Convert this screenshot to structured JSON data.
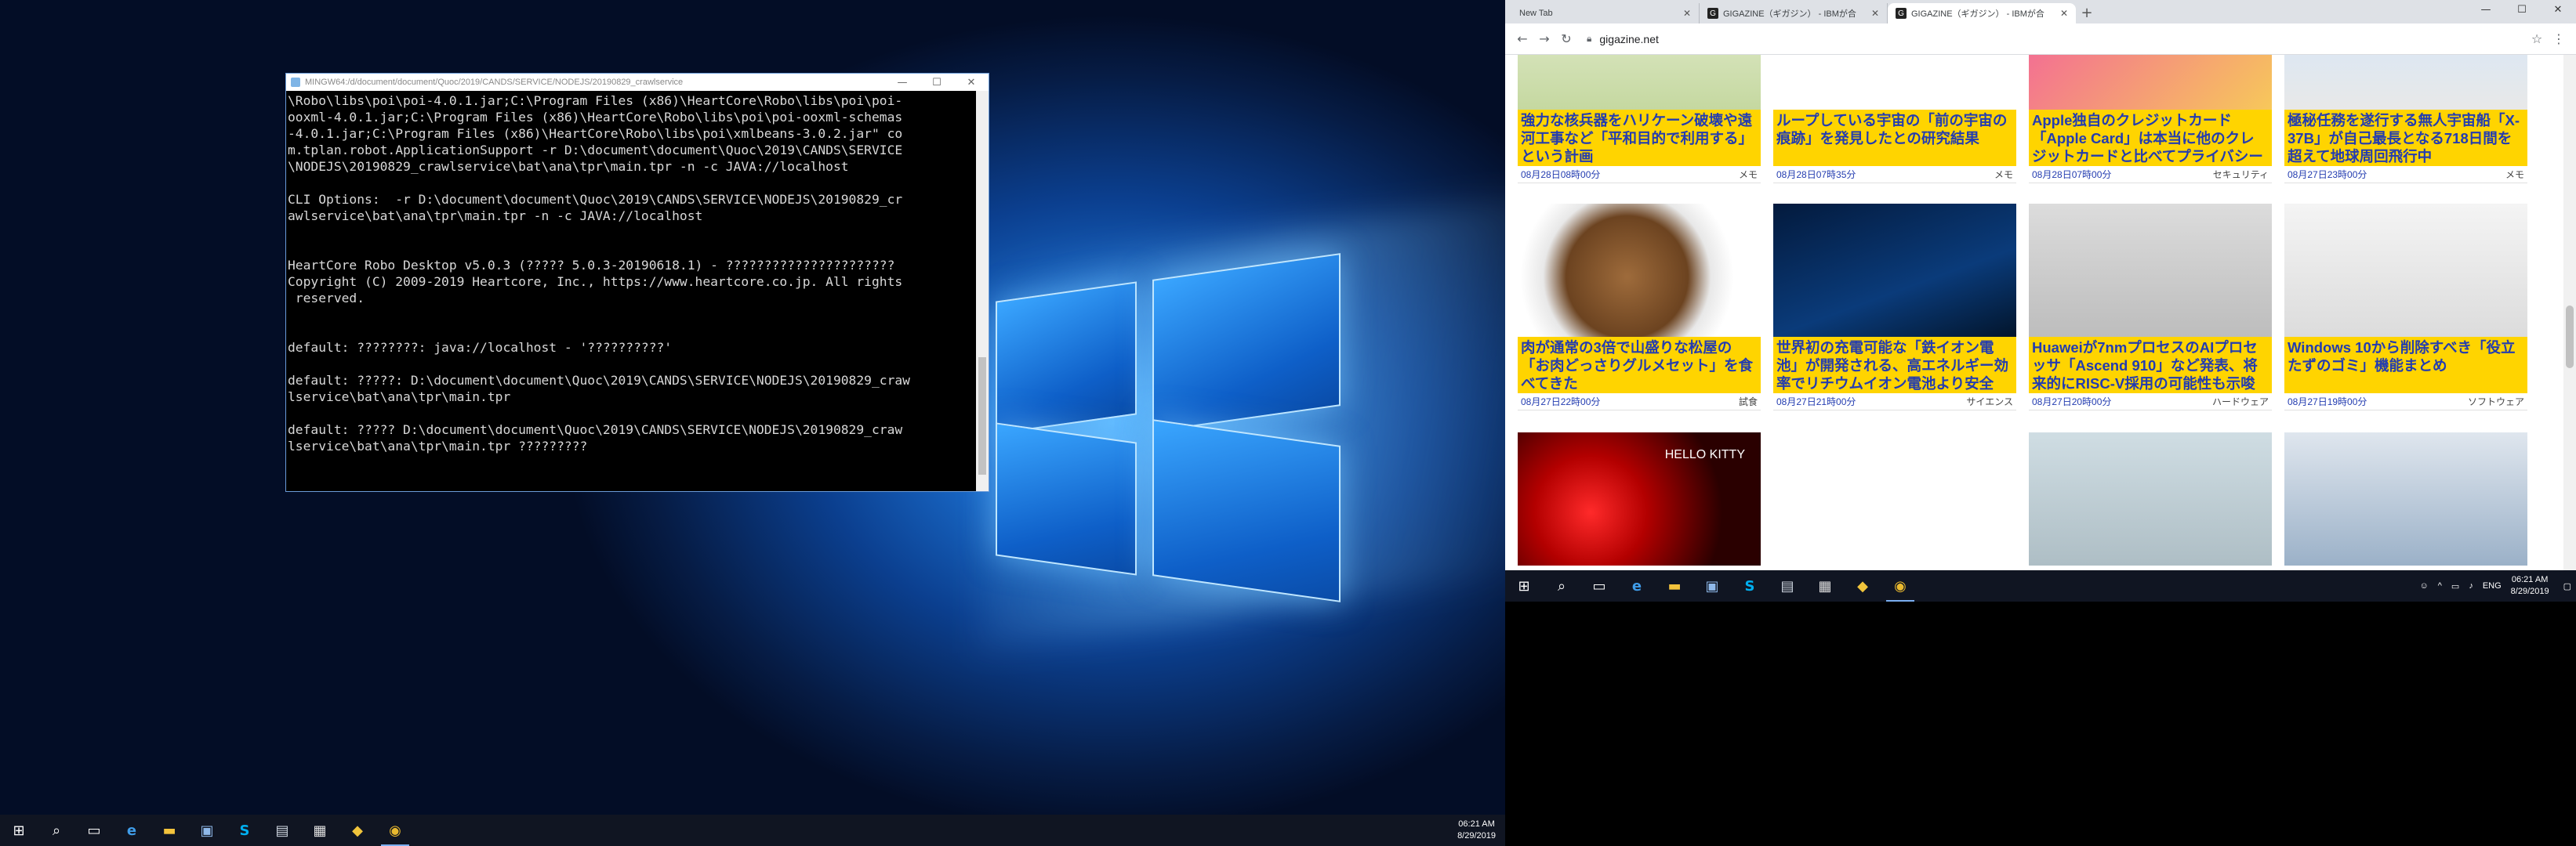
{
  "terminal": {
    "title": "MINGW64:/d/document/document/Quoc/2019/CANDS/SERVICE/NODEJS/20190829_crawlservice",
    "lines": [
      "\\Robo\\libs\\poi\\poi-4.0.1.jar;C:\\Program Files (x86)\\HeartCore\\Robo\\libs\\poi\\poi-",
      "ooxml-4.0.1.jar;C:\\Program Files (x86)\\HeartCore\\Robo\\libs\\poi\\poi-ooxml-schemas",
      "-4.0.1.jar;C:\\Program Files (x86)\\HeartCore\\Robo\\libs\\poi\\xmlbeans-3.0.2.jar\" co",
      "m.tplan.robot.ApplicationSupport -r D:\\document\\document\\Quoc\\2019\\CANDS\\SERVICE",
      "\\NODEJS\\20190829_crawlservice\\bat\\ana\\tpr\\main.tpr -n -c JAVA://localhost",
      "",
      "CLI Options:  -r D:\\document\\document\\Quoc\\2019\\CANDS\\SERVICE\\NODEJS\\20190829_cr",
      "awlservice\\bat\\ana\\tpr\\main.tpr -n -c JAVA://localhost",
      "",
      "",
      "HeartCore Robo Desktop v5.0.3 (????? 5.0.3-20190618.1) - ??????????????????????",
      "Copyright (C) 2009-2019 Heartcore, Inc., https://www.heartcore.co.jp. All rights",
      " reserved.",
      "",
      "",
      "default: ????????: java://localhost - '??????????'",
      "",
      "default: ?????: D:\\document\\document\\Quoc\\2019\\CANDS\\SERVICE\\NODEJS\\20190829_craw",
      "lservice\\bat\\ana\\tpr\\main.tpr",
      "",
      "default: ????? D:\\document\\document\\Quoc\\2019\\CANDS\\SERVICE\\NODEJS\\20190829_craw",
      "lservice\\bat\\ana\\tpr\\main.tpr ?????????"
    ],
    "controls": {
      "min": "—",
      "max": "☐",
      "close": "✕"
    }
  },
  "taskbar_left": {
    "icons": [
      "windows-start",
      "search",
      "task-view",
      "edge",
      "file-explorer",
      "app-generic",
      "skype",
      "app-generic-2",
      "app-notes",
      "app-git",
      "chrome"
    ],
    "time": "06:21 AM",
    "date": "8/29/2019"
  },
  "chrome": {
    "tabs": [
      {
        "title": "New Tab",
        "active": false,
        "icon": ""
      },
      {
        "title": "GIGAZINE（ギガジン） - IBMが合",
        "active": false,
        "icon": "G"
      },
      {
        "title": "GIGAZINE（ギガジン） - IBMが合",
        "active": true,
        "icon": "G"
      }
    ],
    "new_tab": "+",
    "url": "gigazine.net",
    "window_controls": {
      "min": "—",
      "max": "☐",
      "close": "✕"
    }
  },
  "articles": [
    {
      "title": "強力な核兵器をハリケーン破壊や遠河工事など「平和目的で利用する」という計画",
      "date": "08月28日08時00分",
      "cat": "メモ",
      "art": "art-a"
    },
    {
      "title": "ループしている宇宙の「前の宇宙の痕跡」を発見したとの研究結果",
      "date": "08月28日07時35分",
      "cat": "メモ",
      "art": "art-b"
    },
    {
      "title": "Apple独自のクレジットカード「Apple Card」は本当に他のクレジットカードと比べてプライバシー",
      "date": "08月28日07時00分",
      "cat": "セキュリティ",
      "art": "art-c"
    },
    {
      "title": "極秘任務を遂行する無人宇宙船「X-37B」が自己最長となる718日間を超えて地球周回飛行中",
      "date": "08月27日23時00分",
      "cat": "メモ",
      "art": "art-d"
    },
    {
      "title": "肉が通常の3倍で山盛りな松屋の「お肉どっさりグルメセット」を食べてきた",
      "date": "08月27日22時00分",
      "cat": "試食",
      "art": "art-beef"
    },
    {
      "title": "世界初の充電可能な「鉄イオン電池」が開発される、高エネルギー効率でリチウムイオン電池より安全",
      "date": "08月27日21時00分",
      "cat": "サイエンス",
      "art": "art-battery"
    },
    {
      "title": "Huaweiが7nmプロセスのAIプロセッサ「Ascend 910」など発表、将来的にRISC-V採用の可能性も示唆",
      "date": "08月27日20時00分",
      "cat": "ハードウェア",
      "art": "art-chip"
    },
    {
      "title": "Windows 10から削除すべき「役立たずのゴミ」機能まとめ",
      "date": "08月27日19時00分",
      "cat": "ソフトウェア",
      "art": "art-laptop"
    },
    {
      "title": "",
      "date": "",
      "cat": "",
      "art": "art-kitty",
      "img_text": "HELLO KITTY"
    },
    {
      "title": "",
      "date": "",
      "cat": "",
      "art": "art-logos"
    },
    {
      "title": "",
      "date": "",
      "cat": "",
      "art": "art-phones"
    },
    {
      "title": "",
      "date": "",
      "cat": "",
      "art": "art-astro"
    }
  ],
  "taskbar_right": {
    "icons": [
      "windows-start",
      "search",
      "task-view",
      "edge",
      "file-explorer",
      "app-generic",
      "skype",
      "app-generic-2",
      "app-notes",
      "app-git",
      "chrome"
    ],
    "lang": "ENG",
    "time": "06:21 AM",
    "date": "8/29/2019"
  }
}
